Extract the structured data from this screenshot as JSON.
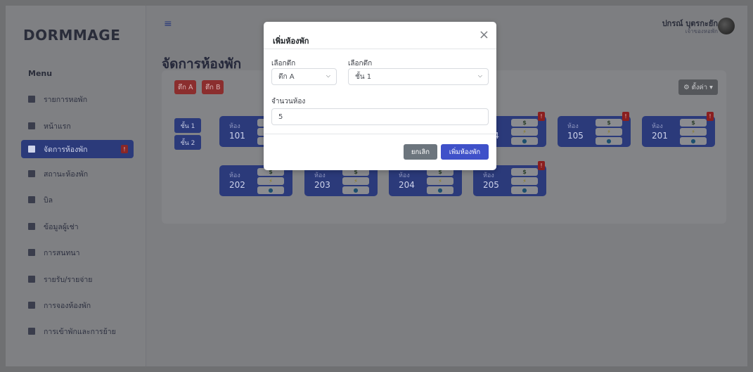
{
  "brand": "DORMMAGE",
  "menu_title": "Menu",
  "sidebar": {
    "items": [
      {
        "label": "รายการหอพัก"
      },
      {
        "label": "หน้าแรก"
      },
      {
        "label": "จัดการห้องพัก",
        "badge": "!"
      },
      {
        "label": "สถานะห้องพัก"
      },
      {
        "label": "บิล"
      },
      {
        "label": "ข้อมูลผู้เช่า"
      },
      {
        "label": "การสนทนา"
      },
      {
        "label": "รายรับ/รายจ่าย"
      },
      {
        "label": "การจองห้องพัก"
      },
      {
        "label": "การเข้าพักและการย้าย"
      }
    ]
  },
  "header": {
    "hamburger": "≡",
    "user_name": "ปกรณ์ บุตรกะยัก",
    "user_role": "เจ้าของหอพัก"
  },
  "page_title": "จัดการห้องพัก",
  "buildings": [
    "ตึก A",
    "ตึก B"
  ],
  "settings_label": "⚙ ตั้งค่า ▾",
  "floors": [
    "ชั้น 1",
    "ชั้น 2"
  ],
  "room_word": "ห้อง",
  "rooms": [
    {
      "num": "101"
    },
    {
      "num": "104"
    },
    {
      "num": "105"
    },
    {
      "num": "201"
    },
    {
      "num": "202"
    },
    {
      "num": "203"
    },
    {
      "num": "204"
    },
    {
      "num": "205"
    }
  ],
  "icons": {
    "money": "$",
    "power": "⚡",
    "water": "●",
    "alert": "!"
  },
  "modal": {
    "title": "เพิ่มห้องพัก",
    "close": "×",
    "building_label": "เลือกตึก",
    "building_value": "ตึก A",
    "floor_label": "เลือกตึก",
    "floor_value": "ชั้น 1",
    "count_label": "จำนวนห้อง",
    "count_value": "5",
    "cancel": "ยกเลิก",
    "submit": "เพิ่มห้องพัก"
  },
  "colors": {
    "accent": "#3f51c9",
    "danger": "#8b2e2e",
    "sidebar_active": "#2b3a7a"
  }
}
